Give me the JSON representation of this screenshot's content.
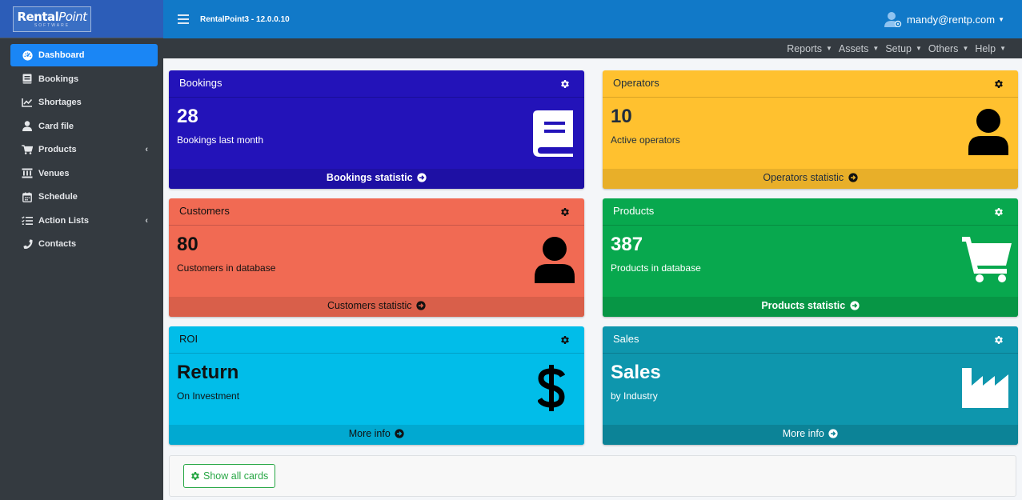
{
  "brand": {
    "logo_main": "Rental",
    "logo_accent": "Point",
    "logo_sub": "SOFTWARE"
  },
  "topbar": {
    "app_title": "RentalPoint3 - 12.0.0.10",
    "user_email": "mandy@rentp.com"
  },
  "menubar": {
    "items": [
      "Reports",
      "Assets",
      "Setup",
      "Others",
      "Help"
    ]
  },
  "sidebar": {
    "items": [
      {
        "label": "Dashboard",
        "icon": "dashboard-icon",
        "active": true
      },
      {
        "label": "Bookings",
        "icon": "book-icon"
      },
      {
        "label": "Shortages",
        "icon": "chart-line-icon"
      },
      {
        "label": "Card file",
        "icon": "user-icon"
      },
      {
        "label": "Products",
        "icon": "cart-icon",
        "has_submenu": true
      },
      {
        "label": "Venues",
        "icon": "landmark-icon"
      },
      {
        "label": "Schedule",
        "icon": "calendar-icon"
      },
      {
        "label": "Action Lists",
        "icon": "list-icon",
        "has_submenu": true
      },
      {
        "label": "Contacts",
        "icon": "phone-icon"
      }
    ]
  },
  "cards": {
    "bookings": {
      "title": "Bookings",
      "value": "28",
      "subtitle": "Bookings last month",
      "footer": "Bookings statistic",
      "icon": "book-icon",
      "color": "#2313b9"
    },
    "operators": {
      "title": "Operators",
      "value": "10",
      "subtitle": "Active operators",
      "footer": "Operators statistic",
      "icon": "user-icon",
      "color": "#ffc12f"
    },
    "customers": {
      "title": "Customers",
      "value": "80",
      "subtitle": "Customers in database",
      "footer": "Customers statistic",
      "icon": "user-icon",
      "color": "#f16a53"
    },
    "products": {
      "title": "Products",
      "value": "387",
      "subtitle": "Products in database",
      "footer": "Products statistic",
      "icon": "cart-icon",
      "color": "#08a84e"
    },
    "roi": {
      "title": "ROI",
      "value": "Return",
      "subtitle": "On Investment",
      "footer": "More info",
      "icon": "dollar-icon",
      "color": "#01bde9"
    },
    "sales": {
      "title": "Sales",
      "value": "Sales",
      "subtitle": "by Industry",
      "footer": "More info",
      "icon": "industry-icon",
      "color": "#0e96ad"
    }
  },
  "bottom": {
    "show_all_label": "Show all cards"
  }
}
